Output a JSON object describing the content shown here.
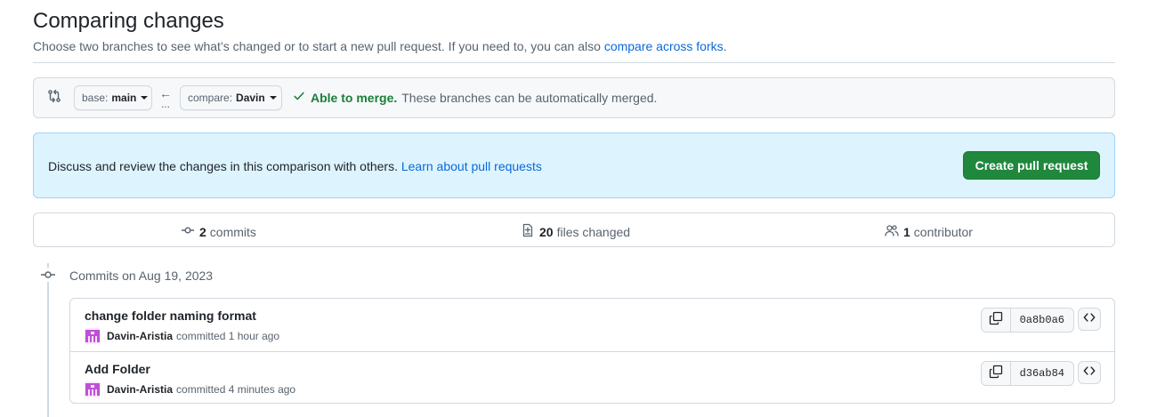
{
  "header": {
    "title": "Comparing changes",
    "subtitle_prefix": "Choose two branches to see what’s changed or to start a new pull request. If you need to, you can also ",
    "subtitle_link": "compare across forks",
    "subtitle_suffix": "."
  },
  "range": {
    "base_label": "base:",
    "base_value": "main",
    "arrow": "←",
    "dots": "...",
    "compare_label": "compare:",
    "compare_value": "Davin",
    "merge_status": "Able to merge.",
    "merge_detail": "These branches can be automatically merged."
  },
  "flash": {
    "text": "Discuss and review the changes in this comparison with others.",
    "link": "Learn about pull requests",
    "button": "Create pull request"
  },
  "summary": {
    "commits_count": "2",
    "commits_label": "commits",
    "files_count": "20",
    "files_label": "files changed",
    "contributors_count": "1",
    "contributors_label": "contributor"
  },
  "timeline": {
    "date_label": "Commits on Aug 19, 2023",
    "commits": [
      {
        "message": "change folder naming format",
        "author": "Davin-Aristia",
        "meta": "committed 1 hour ago",
        "sha": "0a8b0a6"
      },
      {
        "message": "Add Folder",
        "author": "Davin-Aristia",
        "meta": "committed 4 minutes ago",
        "sha": "d36ab84"
      }
    ]
  },
  "colors": {
    "accent_link": "#0969da",
    "success": "#1a7f37",
    "primary_button": "#1f883d",
    "flash_bg": "#ddf4ff",
    "avatar": "#c04fd8"
  },
  "icons": {
    "range": "git-compare-icon",
    "merge": "check-icon",
    "commits": "git-commit-icon",
    "files": "file-diff-icon",
    "contributors": "people-icon",
    "copy": "copy-icon",
    "browse": "code-icon"
  }
}
